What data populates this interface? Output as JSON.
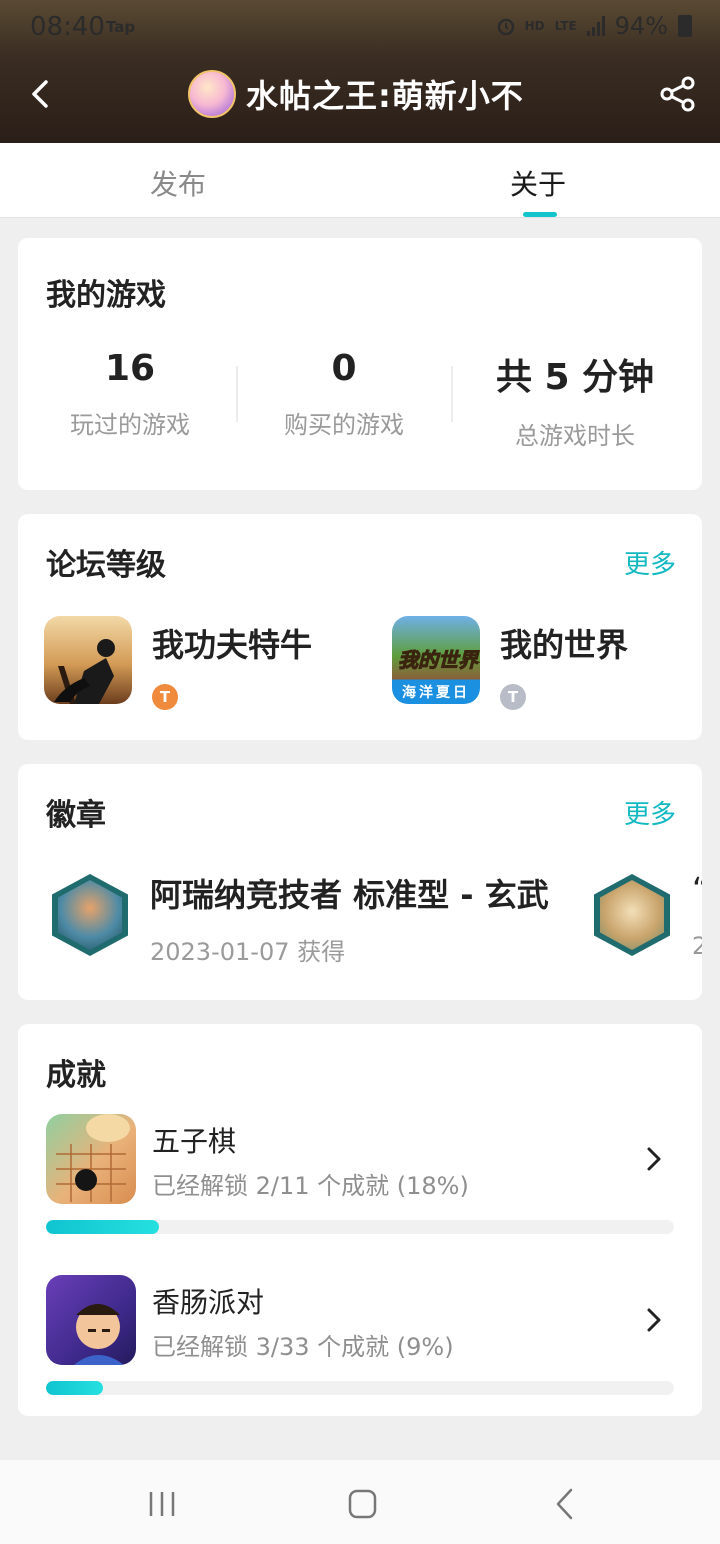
{
  "status_bar": {
    "time": "08:40",
    "app_tag": "Tap",
    "network_hd": "HD",
    "network_lte": "LTE",
    "battery": "94%"
  },
  "header": {
    "title": "水帖之王:萌新小不"
  },
  "tabs": [
    {
      "label": "发布",
      "selected": false
    },
    {
      "label": "关于",
      "selected": true
    }
  ],
  "accent_color": "#15c5ce",
  "my_games": {
    "title": "我的游戏",
    "stats": [
      {
        "value": "16",
        "label": "玩过的游戏"
      },
      {
        "value": "0",
        "label": "购买的游戏"
      },
      {
        "value": "共 5 分钟",
        "label": "总游戏时长"
      }
    ]
  },
  "forum_level": {
    "title": "论坛等级",
    "more": "更多",
    "items": [
      {
        "name": "我功夫特牛",
        "level_badge": "T3",
        "icon": "kungfu-game-icon",
        "badge_color": "#f08a3c"
      },
      {
        "name": "我的世界",
        "level_badge": "T3",
        "icon": "minecraft-game-icon",
        "badge_color": "#b7bcc6",
        "icon_text": "我的世界",
        "icon_caption": "海洋夏日"
      }
    ]
  },
  "badges": {
    "title": "徽章",
    "more": "更多",
    "items": [
      {
        "name": "阿瑞纳竞技者 标准型 - 玄武",
        "date": "2023-01-07 获得",
        "icon": "arena-badge-icon"
      },
      {
        "name": "“",
        "date": "2",
        "icon": "cartoon-badge-icon"
      }
    ]
  },
  "achievements": {
    "title": "成就",
    "items": [
      {
        "name": "五子棋",
        "progress_text": "已经解锁 2/11 个成就 (18%)",
        "progress": 0.18,
        "icon": "gomoku-game-icon"
      },
      {
        "name": "香肠派对",
        "progress_text": "已经解锁 3/33 个成就 (9%)",
        "progress": 0.09,
        "icon": "sausage-party-game-icon"
      }
    ]
  }
}
